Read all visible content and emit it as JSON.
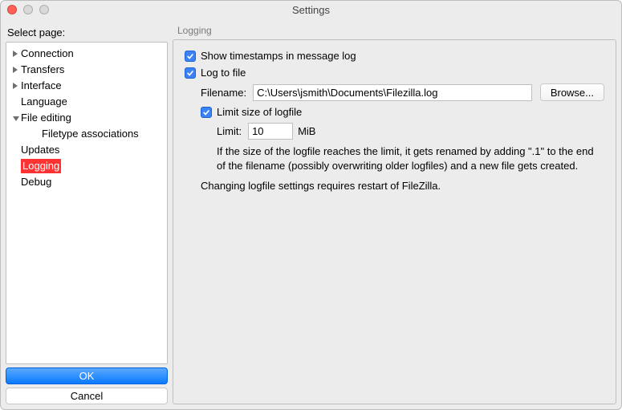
{
  "window": {
    "title": "Settings"
  },
  "sidebar": {
    "label": "Select page:",
    "items": [
      {
        "label": "Connection",
        "expandable": true,
        "expanded": false,
        "level": 0
      },
      {
        "label": "Transfers",
        "expandable": true,
        "expanded": false,
        "level": 0
      },
      {
        "label": "Interface",
        "expandable": true,
        "expanded": false,
        "level": 0
      },
      {
        "label": "Language",
        "expandable": false,
        "expanded": false,
        "level": 0
      },
      {
        "label": "File editing",
        "expandable": true,
        "expanded": true,
        "level": 0
      },
      {
        "label": "Filetype associations",
        "expandable": false,
        "expanded": false,
        "level": 1
      },
      {
        "label": "Updates",
        "expandable": false,
        "expanded": false,
        "level": 0
      },
      {
        "label": "Logging",
        "expandable": false,
        "expanded": false,
        "level": 0,
        "selected": true
      },
      {
        "label": "Debug",
        "expandable": false,
        "expanded": false,
        "level": 0
      }
    ],
    "ok_label": "OK",
    "cancel_label": "Cancel"
  },
  "panel": {
    "title": "Logging",
    "show_timestamps_label": "Show timestamps in message log",
    "log_to_file_label": "Log to file",
    "filename_label": "Filename:",
    "filename_value": "C:\\Users\\jsmith\\Documents\\Filezilla.log",
    "browse_label": "Browse...",
    "limit_size_label": "Limit size of logfile",
    "limit_label": "Limit:",
    "limit_value": "10",
    "limit_unit": "MiB",
    "limit_note": "If the size of the logfile reaches the limit, it gets renamed by adding \".1\" to the end of the filename (possibly overwriting older logfiles) and a new file gets created.",
    "restart_note": "Changing logfile settings requires restart of FileZilla."
  }
}
